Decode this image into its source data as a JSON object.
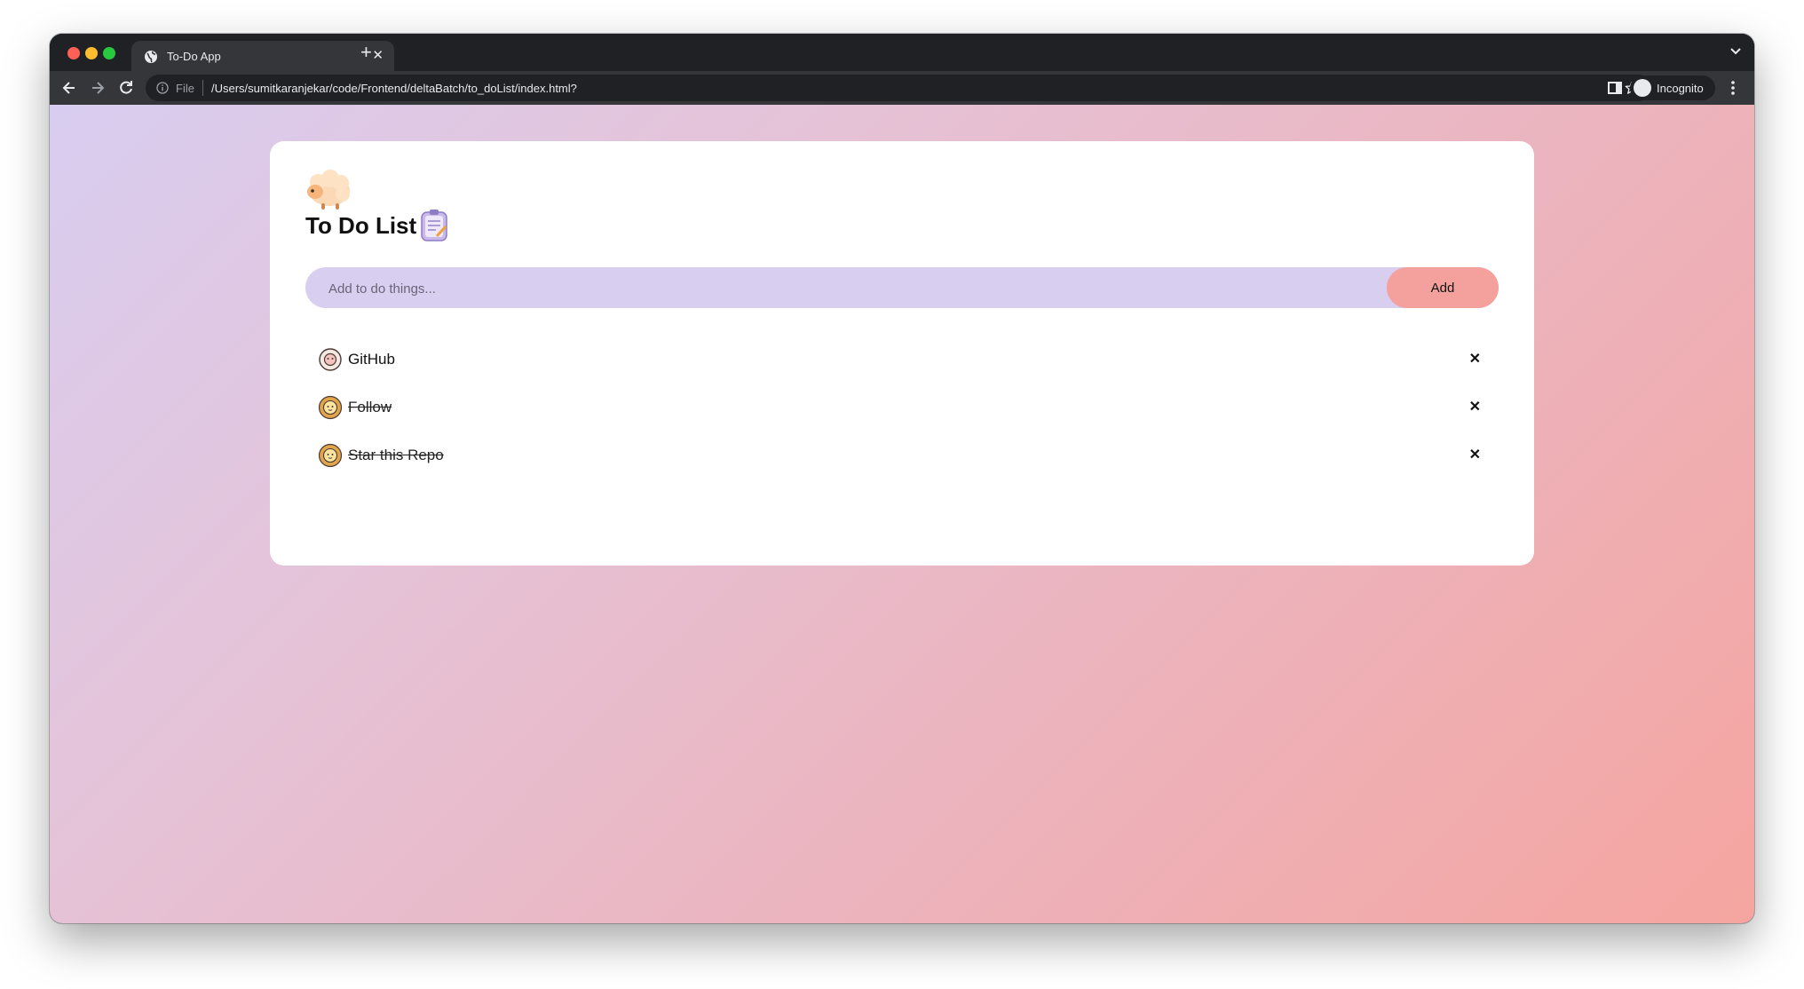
{
  "browser": {
    "tab": {
      "title": "To-Do App",
      "close": "✕"
    },
    "new_tab": "+",
    "omnibox": {
      "scheme": "File",
      "url": "/Users/sumitkaranjekar/code/Frontend/deltaBatch/to_doList/index.html?"
    },
    "profile": {
      "label": "Incognito"
    }
  },
  "app": {
    "title": "To Do List",
    "input": {
      "placeholder": "Add to do things...",
      "value": ""
    },
    "add_label": "Add",
    "delete_glyph": "✕",
    "tasks": [
      {
        "text": "GitHub",
        "done": false
      },
      {
        "text": "Follow",
        "done": true
      },
      {
        "text": "Star this Repo",
        "done": true
      }
    ]
  },
  "colors": {
    "card": "#ffffff",
    "input_bg": "#d8cef0",
    "add_button": "#f4a09c",
    "gradient_start": "#d8cdf0",
    "gradient_end": "#f5a5a0"
  },
  "icons": {
    "tab_favicon": "globe-icon",
    "header": "sheep-icon",
    "title": "notepad-icon",
    "task_pending": "sheep-face-icon",
    "task_done": "lion-face-icon"
  }
}
